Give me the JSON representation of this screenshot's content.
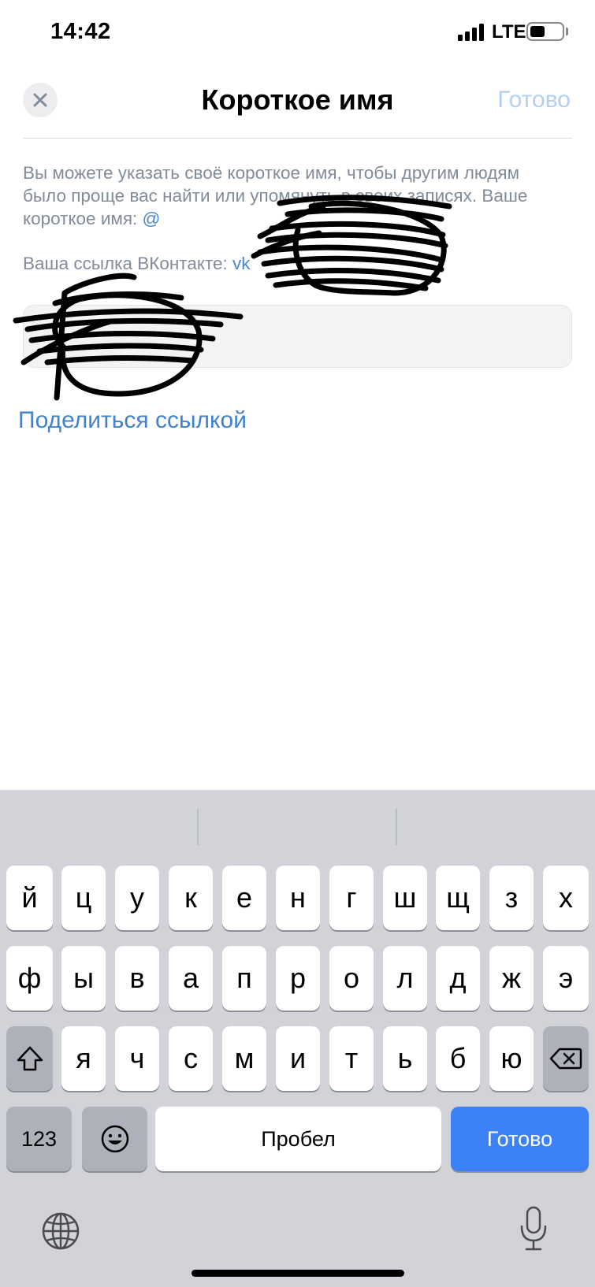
{
  "status_bar": {
    "time": "14:42",
    "network": "LTE",
    "battery_level": 0.4
  },
  "header": {
    "title": "Короткое имя",
    "done_label": "Готово",
    "done_color": "#b4cff0"
  },
  "description": {
    "text": "Вы можете указать своё короткое имя, чтобы другим людям было проще вас найти или упомянуть в своих записях. Ваше короткое имя: ",
    "link_start": "@"
  },
  "profile_link": {
    "label": "Ваша ссылка ВКонтакте: ",
    "link_start": "vk"
  },
  "share_link_label": "Поделиться ссылкой",
  "colors": {
    "accent": "#3f82d0",
    "secondary_text": "#818c99",
    "keyboard_bg": "#d1d3d9",
    "return_key": "#3c82f6"
  },
  "keyboard": {
    "row1": [
      "й",
      "ц",
      "у",
      "к",
      "е",
      "н",
      "г",
      "ш",
      "щ",
      "з",
      "х"
    ],
    "row2": [
      "ф",
      "ы",
      "в",
      "а",
      "п",
      "р",
      "о",
      "л",
      "д",
      "ж",
      "э"
    ],
    "row3": [
      "я",
      "ч",
      "с",
      "м",
      "и",
      "т",
      "ь",
      "б",
      "ю"
    ],
    "shift_icon": "shift-icon",
    "backspace_icon": "backspace-icon",
    "numbers_label": "123",
    "emoji_icon": "emoji-icon",
    "space_label": "Пробел",
    "return_label": "Готово",
    "globe_icon": "globe-icon",
    "mic_icon": "microphone-icon"
  }
}
